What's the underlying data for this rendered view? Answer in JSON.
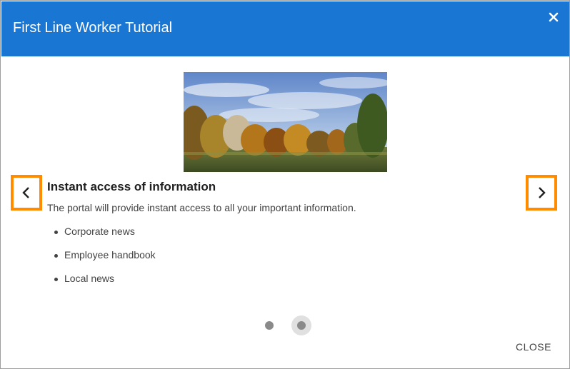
{
  "dialog": {
    "title": "First Line Worker Tutorial",
    "close_icon": "close-icon",
    "header_color": "#1976d2"
  },
  "slide": {
    "image": "landscape-autumn-trees",
    "title": "Instant access of information",
    "description": "The portal will provide instant access to all your important information.",
    "bullets": [
      "Corporate news",
      "Employee handbook",
      "Local news"
    ]
  },
  "navigation": {
    "prev_icon": "chevron-left-icon",
    "next_icon": "chevron-right-icon",
    "highlight_color": "#ff8c00",
    "pages": 2,
    "current_page": 2
  },
  "footer": {
    "close_label": "CLOSE"
  }
}
